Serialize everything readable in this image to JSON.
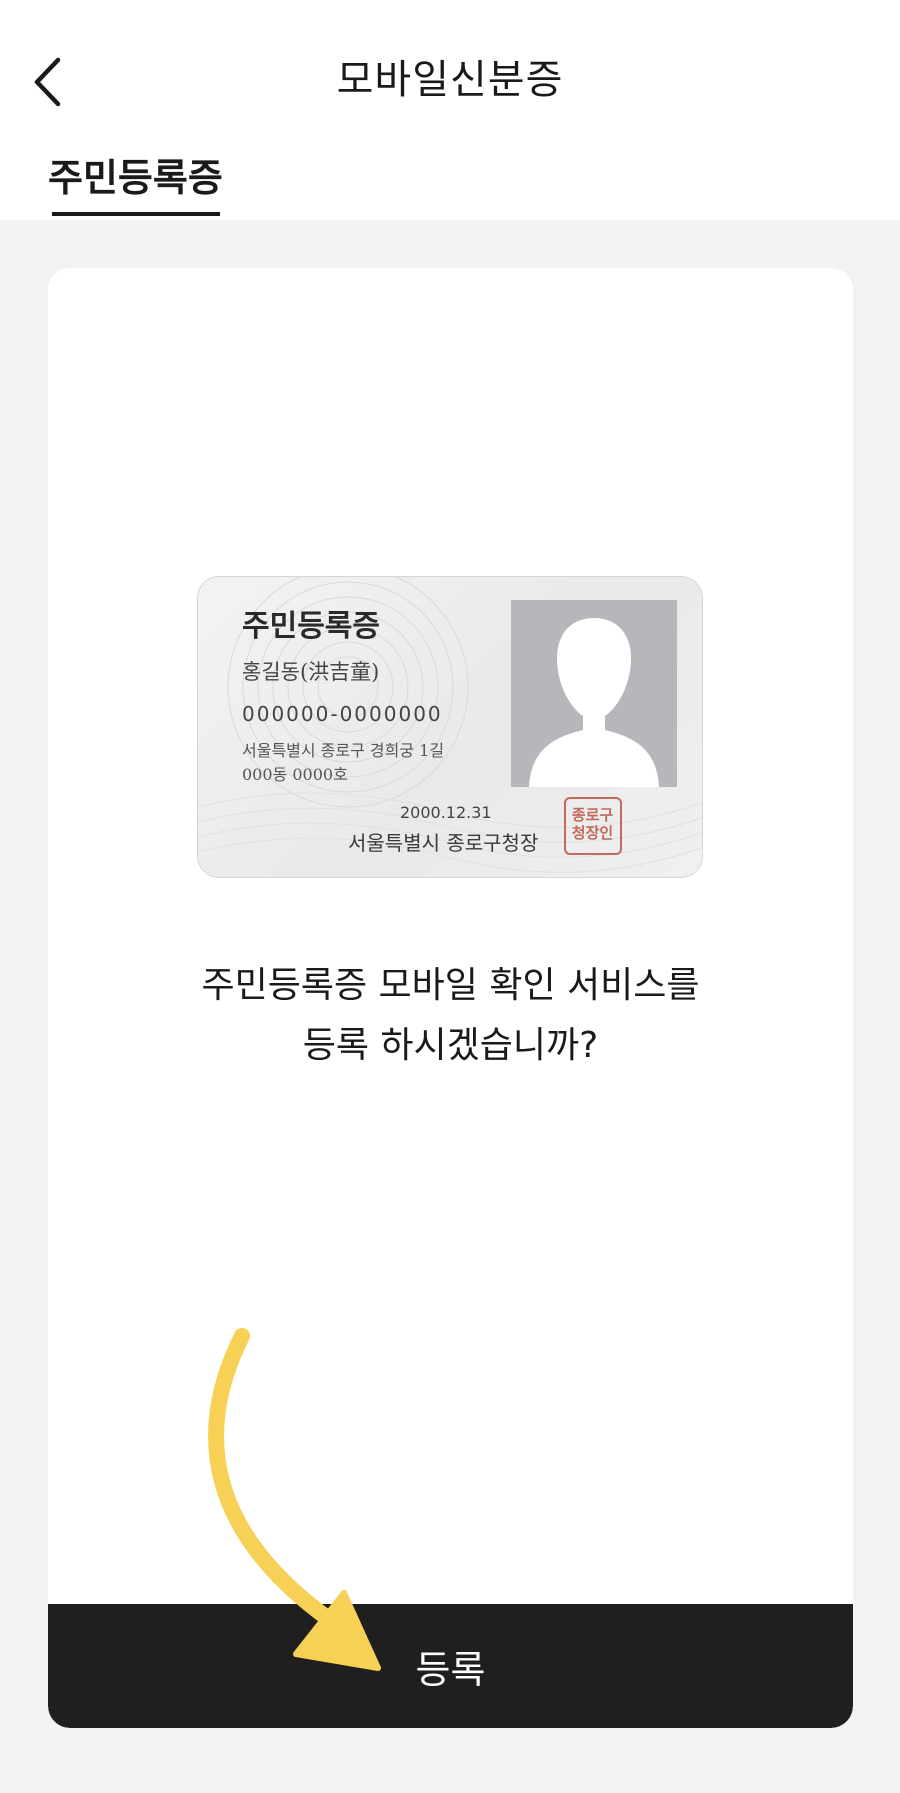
{
  "header": {
    "title": "모바일신분증",
    "back_icon": "chevron-left-icon"
  },
  "tabs": [
    {
      "label": "주민등록증",
      "active": true
    }
  ],
  "id_card": {
    "title": "주민등록증",
    "name": "홍길동(洪吉童)",
    "number": "000000-0000000",
    "address_line1": "서울특별시 종로구 경희궁 1길",
    "address_line2": "000동 0000호",
    "issue_date": "2000.12.31",
    "issuer": "서울특별시 종로구청장",
    "seal_line1": "종로구",
    "seal_line2": "청장인",
    "photo_icon": "person-silhouette-icon"
  },
  "message": {
    "line1": "주민등록증 모바일 확인 서비스를",
    "line2": "등록 하시겠습니까?"
  },
  "register_button": {
    "label": "등록"
  },
  "annotation": {
    "arrow_color": "#f7d155",
    "arrow_icon": "curved-arrow-icon"
  },
  "colors": {
    "background": "#f1f2f4",
    "button": "#1f1f1f",
    "seal": "#c26a5c"
  }
}
